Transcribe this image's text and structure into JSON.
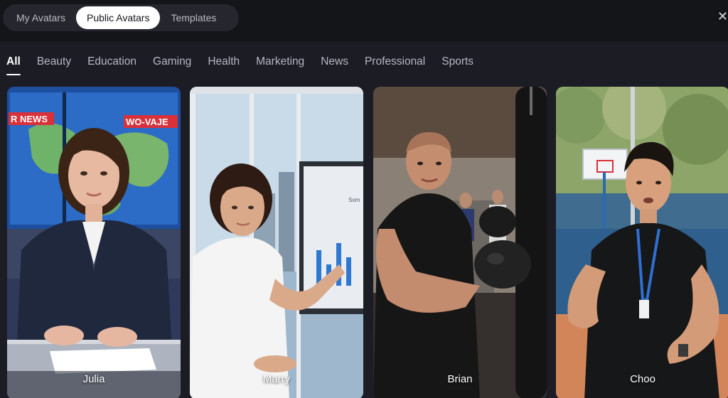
{
  "top_tabs": [
    {
      "label": "My Avatars",
      "active": false
    },
    {
      "label": "Public Avatars",
      "active": true
    },
    {
      "label": "Templates",
      "active": false
    }
  ],
  "close_icon": "close-icon",
  "categories": [
    {
      "label": "All",
      "active": true
    },
    {
      "label": "Beauty"
    },
    {
      "label": "Education"
    },
    {
      "label": "Gaming"
    },
    {
      "label": "Health"
    },
    {
      "label": "Marketing"
    },
    {
      "label": "News"
    },
    {
      "label": "Professional"
    },
    {
      "label": "Sports"
    }
  ],
  "avatars": [
    {
      "name": "Julia",
      "banner_left": "R NEWS",
      "banner_right": "WO-VAJE"
    },
    {
      "name": "Marry",
      "screen_text": "Som"
    },
    {
      "name": "Brian"
    },
    {
      "name": "Choo"
    }
  ],
  "colors": {
    "background": "#1b1c24",
    "top_bar": "#141519",
    "active_tab": "#ffffff",
    "news_red": "#d9313a"
  }
}
